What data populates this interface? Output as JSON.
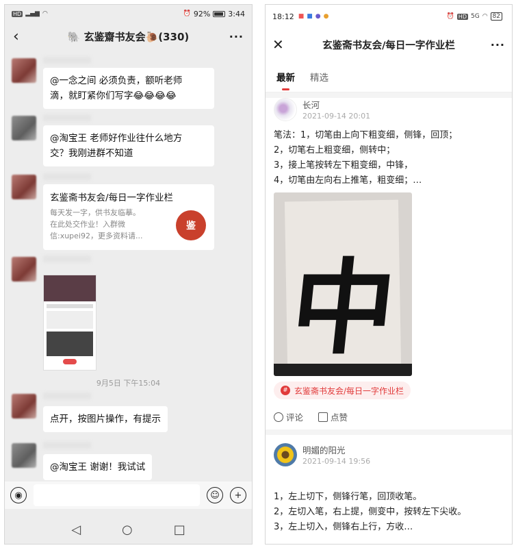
{
  "left": {
    "status": {
      "battery": "92%",
      "battery_level": 0.92,
      "time": "3:44",
      "hd": "HD"
    },
    "header": {
      "back_icon": "‹",
      "title": "🐘 玄鉴齋书友会🐌(330)",
      "more_icon": "···"
    },
    "messages": [
      {
        "lines": [
          "@一念之间  必须负责，额听老师",
          "滴，就盯紧你们写字😂😂😂😂"
        ]
      },
      {
        "lines": [
          "@淘宝王  老师好作业往什么地方",
          "交？我刚进群不知道"
        ]
      }
    ],
    "card": {
      "title": "玄鉴斋书友会/每日一字作业栏",
      "desc": [
        "每天发一字，供书友临摹。",
        "在此处交作业！入群微",
        "信:xupei92，更多资料请..."
      ],
      "seal_text": "鉴"
    },
    "timestamp": "9月5日 下午15:04",
    "messages2": [
      {
        "text": "点开，按图片操作，有提示"
      },
      {
        "text": "@淘宝王  谢谢！我试试"
      }
    ],
    "input": {
      "voice_icon": "voice-icon",
      "emoji_icon": "☺",
      "plus_icon": "+"
    },
    "nav": {
      "back": "◁",
      "home": "○",
      "recent": "□"
    }
  },
  "right": {
    "status": {
      "time": "18:12",
      "network": "5G",
      "battery": "82"
    },
    "header": {
      "close_icon": "✕",
      "title": "玄鉴斋书友会/每日一字作业栏",
      "more_icon": "···"
    },
    "tabs": [
      {
        "label": "最新"
      },
      {
        "label": "精选"
      }
    ],
    "post1": {
      "author": "长河",
      "date": "2021-09-14 20:01",
      "lines": [
        "笔法：1，切笔由上向下粗变细，侧锋，回顶；",
        "2，切笔右上粗变细，侧转中；",
        "3，接上笔按转左下粗变细，中锋，",
        "4，切笔由左向右上推笔，粗变细；…"
      ],
      "photo_char": "中",
      "tag": "玄鉴斋书友会/每日一字作业栏",
      "comment": "评论",
      "like": "点赞"
    },
    "post2": {
      "author": "明媚的阳光",
      "date": "2021-09-14 19:56",
      "lines": [
        "1，左上切下，侧锋行笔，回顶收笔。",
        "2，左切入笔，右上提，侧变中，按转左下尖收。",
        "3，左上切入，侧锋右上行，方收…"
      ]
    }
  }
}
